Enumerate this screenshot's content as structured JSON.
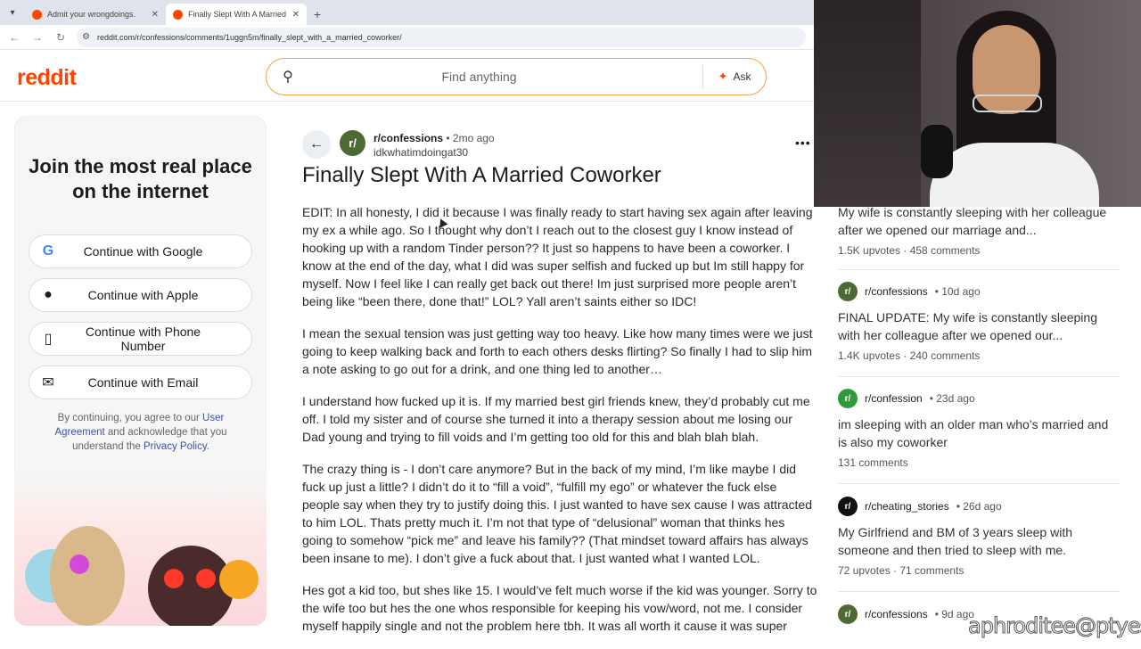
{
  "browser": {
    "tabs": [
      {
        "title": "Admit your wrongdoings.",
        "active": false
      },
      {
        "title": "Finally Slept With A Married Co",
        "active": true
      }
    ],
    "url": "reddit.com/r/confessions/comments/1uggn5m/finally_slept_with_a_married_coworker/"
  },
  "header": {
    "logo": "reddit",
    "search_placeholder": "Find anything",
    "ask_label": "Ask"
  },
  "signin": {
    "heading": "Join the most real place on the internet",
    "buttons": [
      {
        "label": "Continue with Google",
        "icon": "google-icon"
      },
      {
        "label": "Continue with Apple",
        "icon": "apple-icon"
      },
      {
        "label": "Continue with Phone Number",
        "icon": "phone-icon"
      },
      {
        "label": "Continue with Email",
        "icon": "mail-icon"
      }
    ],
    "legal_prefix": "By continuing, you agree to our",
    "legal_link1": "User Agreement",
    "legal_mid": "and acknowledge that you understand the",
    "legal_link2": "Privacy Policy",
    "legal_suffix": "."
  },
  "post": {
    "subreddit": "r/confessions",
    "age": "• 2mo ago",
    "author": "idkwhatimdoingat30",
    "title": "Finally Slept With A Married Coworker",
    "paragraphs": [
      "EDIT: In all honesty, I did it because I was finally ready to start having sex again after leaving my ex a while ago. So I thought why don’t I reach out to the closest guy I know instead of hooking up with a random Tinder person?? It just so happens to have been a coworker. I know at the end of the day, what I did was super selfish and fucked up but Im still happy for myself. Now I feel like I can really get back out there! Im just surprised more people aren’t being like “been there, done that!” LOL? Yall aren’t saints either so IDC!",
      "I mean the sexual tension was just getting way too heavy. Like how many times were we just going to keep walking back and forth to each others desks flirting? So finally I had to slip him a note asking to go out for a drink, and one thing led to another…",
      "I understand how fucked up it is. If my married best girl friends knew, they’d probably cut me off. I told my sister and of course she turned it into a therapy session about me losing our Dad young and trying to fill voids and I’m getting too old for this and blah blah blah.",
      "The crazy thing is - I don’t care anymore? But in the back of my mind, I’m like maybe I did fuck up just a little? I didn’t do it to “fill a void”, “fulfill my ego” or whatever the fuck else people say when they try to justify doing this. I just wanted to have sex cause I was attracted to him LOL. Thats pretty much it. I’m not that type of “delusional” woman that thinks hes going to somehow “pick me” and leave his family?? (That mindset toward affairs has always been insane to me). I don’t give a fuck about that. I just wanted what I wanted LOL.",
      "Hes got a kid too, but shes like 15. I would’ve felt much worse if the kid was younger. Sorry to the wife too but hes the one whos responsible for keeping his vow/word, not me. I consider myself happily single and not the problem here tbh. It was all worth it cause it was super"
    ]
  },
  "sidebar": {
    "items": [
      {
        "subreddit": "",
        "age": "",
        "title": "My wife is constantly sleeping with her colleague after we opened our marriage and...",
        "meta": "1.5K upvotes · 458 comments"
      },
      {
        "subreddit": "r/confessions",
        "age": "• 10d ago",
        "title": "FINAL UPDATE: My wife is constantly sleeping with her colleague after we opened our...",
        "meta": "1.4K upvotes · 240 comments"
      },
      {
        "subreddit": "r/confession",
        "age": "• 23d ago",
        "title": "im sleeping with an older man who’s married and is also my coworker",
        "meta": "131 comments"
      },
      {
        "subreddit": "r/cheating_stories",
        "age": "• 26d ago",
        "title": "My Girlfriend and BM of 3 years sleep with someone and then tried to sleep with me.",
        "meta": "72 upvotes · 71 comments"
      },
      {
        "subreddit": "r/confessions",
        "age": "• 9d ago",
        "title": "",
        "meta": ""
      }
    ]
  },
  "watermark": "aphroditee@ptyes"
}
